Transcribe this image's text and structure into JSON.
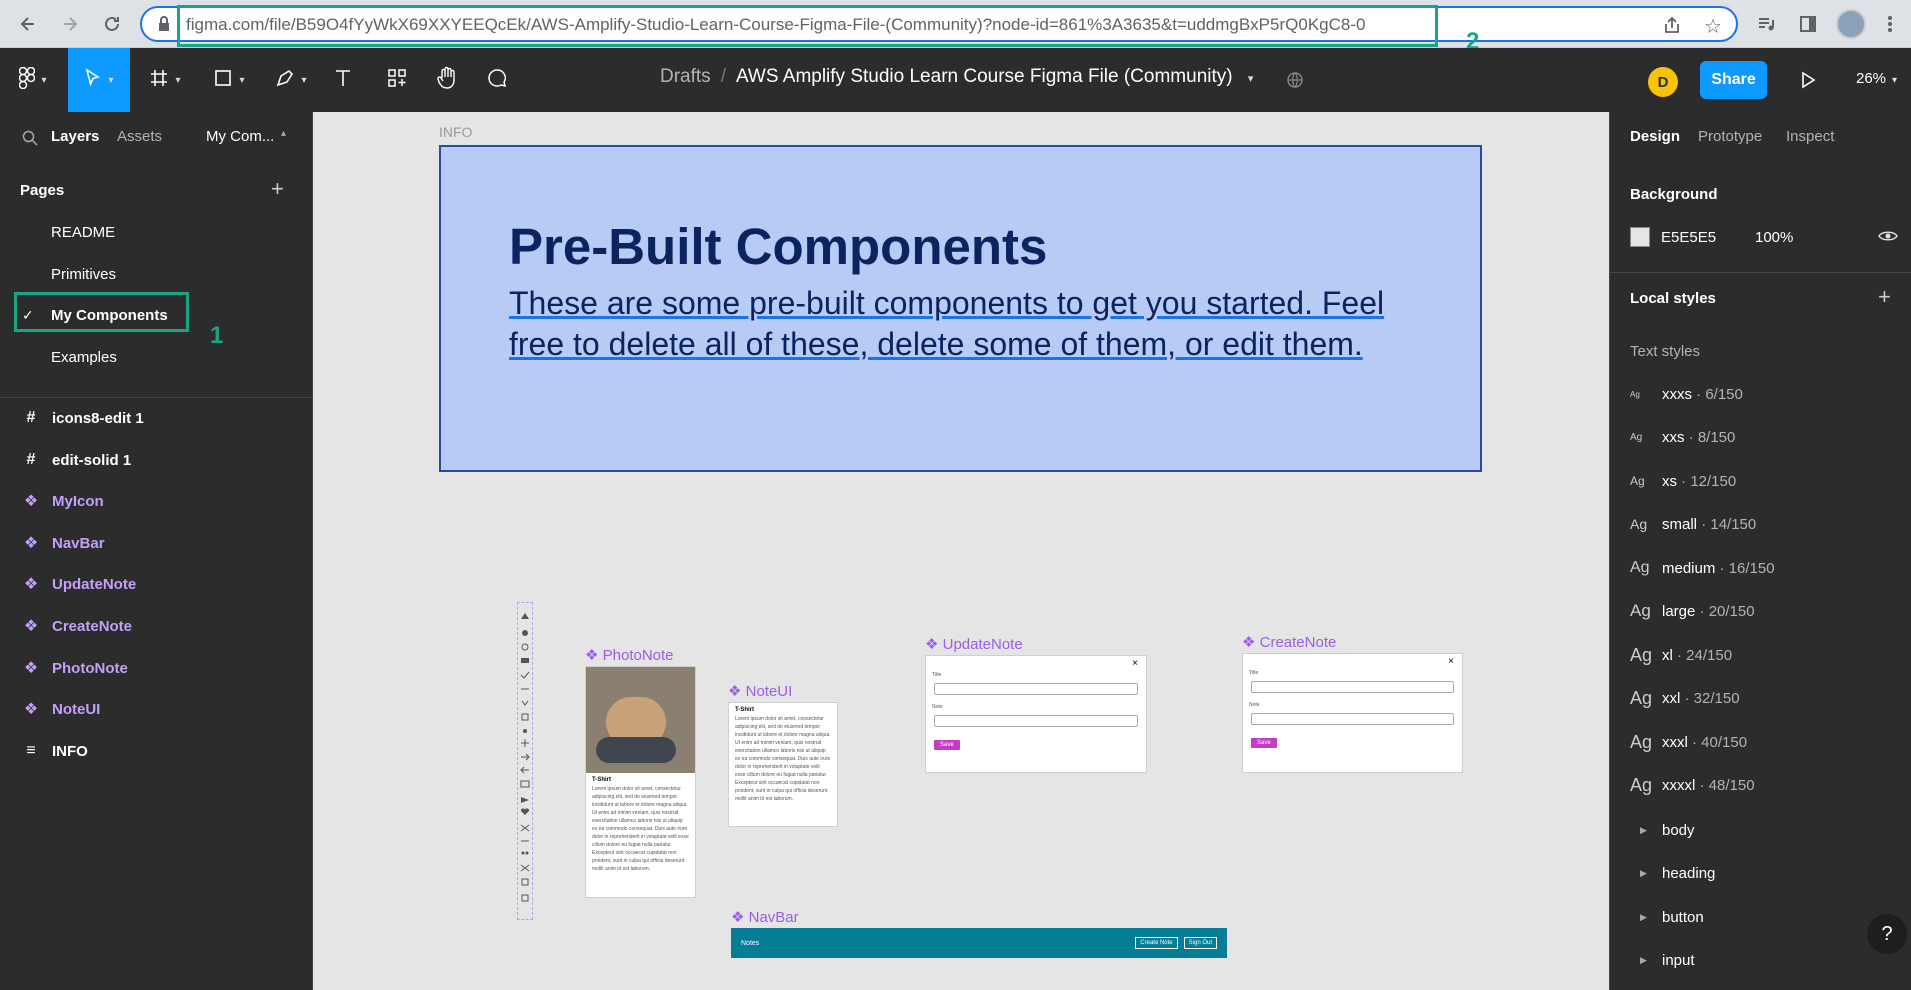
{
  "browser": {
    "url": "figma.com/file/B59O4fYyWkX69XXYEEQcEk/AWS-Amplify-Studio-Learn-Course-Figma-File-(Community)?node-id=861%3A3635&t=uddmgBxP5rQ0KgC8-0",
    "annotation_1": "1",
    "annotation_2": "2"
  },
  "toolbar": {
    "breadcrumb_drafts": "Drafts",
    "breadcrumb_sep": "/",
    "file_title": "AWS Amplify Studio Learn Course Figma File (Community)",
    "avatar_letter": "D",
    "share_label": "Share",
    "zoom": "26%"
  },
  "left_panel": {
    "tabs": [
      "Layers",
      "Assets",
      "My Com..."
    ],
    "pages_title": "Pages",
    "pages": [
      "README",
      "Primitives",
      "My Components",
      "Examples"
    ],
    "selected_page": "My Components",
    "layers": [
      {
        "label": "icons8-edit 1",
        "icon": "frame-icon"
      },
      {
        "label": "edit-solid 1",
        "icon": "frame-icon"
      },
      {
        "label": "MyIcon",
        "icon": "component-icon"
      },
      {
        "label": "NavBar",
        "icon": "component-icon"
      },
      {
        "label": "UpdateNote",
        "icon": "component-icon"
      },
      {
        "label": "CreateNote",
        "icon": "component-icon"
      },
      {
        "label": "PhotoNote",
        "icon": "component-icon"
      },
      {
        "label": "NoteUI",
        "icon": "component-icon"
      },
      {
        "label": "INFO",
        "icon": "text-frame-icon"
      }
    ]
  },
  "canvas": {
    "info_label": "INFO",
    "info_title": "Pre-Built Components",
    "info_body": "These are some pre-built components to get you started. Feel free to delete all of these, delete some of them, or edit them.",
    "components": {
      "photonote": "PhotoNote",
      "noteui": "NoteUI",
      "updatenote": "UpdateNote",
      "createnote": "CreateNote",
      "navbar": "NavBar"
    },
    "card_title": "T-Shirt",
    "lorem": "Lorem ipsum dolor sit amet, consectetur adipiscing elit, sed do eiusmod tempor incididunt ut labore et dolore magna aliqua. Ut enim ad minim veniam, quis nostrud exercitation ullamco laboris nisi ut aliquip ex ea commodo consequat. Duis aute irure dolor in reprehenderit in voluptate velit esse cillum dolore eu fugiat nulla pariatur. Excepteur sint occaecat cupidatat non proident, sunt in culpa qui officia deserunt mollit anim id est laborum.",
    "form_title_label": "Title",
    "form_note_label": "Note",
    "form_save": "Save",
    "form_close": "×",
    "navbar_title": "Notes",
    "navbar_create": "Create Note",
    "navbar_signout": "Sign Out"
  },
  "right_panel": {
    "tabs": [
      "Design",
      "Prototype",
      "Inspect"
    ],
    "background_title": "Background",
    "background_hex": "E5E5E5",
    "background_opacity": "100%",
    "local_styles_title": "Local styles",
    "text_styles_title": "Text styles",
    "text_styles": [
      {
        "ag": "Ag",
        "name": "xxxs",
        "spec": "· 6/150"
      },
      {
        "ag": "Ag",
        "name": "xxs",
        "spec": "· 8/150"
      },
      {
        "ag": "Ag",
        "name": "xs",
        "spec": "· 12/150"
      },
      {
        "ag": "Ag",
        "name": "small",
        "spec": "· 14/150"
      },
      {
        "ag": "Ag",
        "name": "medium",
        "spec": "· 16/150"
      },
      {
        "ag": "Ag",
        "name": "large",
        "spec": "· 20/150"
      },
      {
        "ag": "Ag",
        "name": "xl",
        "spec": "· 24/150"
      },
      {
        "ag": "Ag",
        "name": "xxl",
        "spec": "· 32/150"
      },
      {
        "ag": "Ag",
        "name": "xxxl",
        "spec": "· 40/150"
      },
      {
        "ag": "Ag",
        "name": "xxxxl",
        "spec": "· 48/150"
      }
    ],
    "groups": [
      "body",
      "heading",
      "button",
      "input"
    ],
    "help": "?"
  },
  "colors": {
    "accent": "#0d99ff",
    "annotation": "#1aa385",
    "component": "#c59ffb",
    "navbar": "#047d95"
  }
}
